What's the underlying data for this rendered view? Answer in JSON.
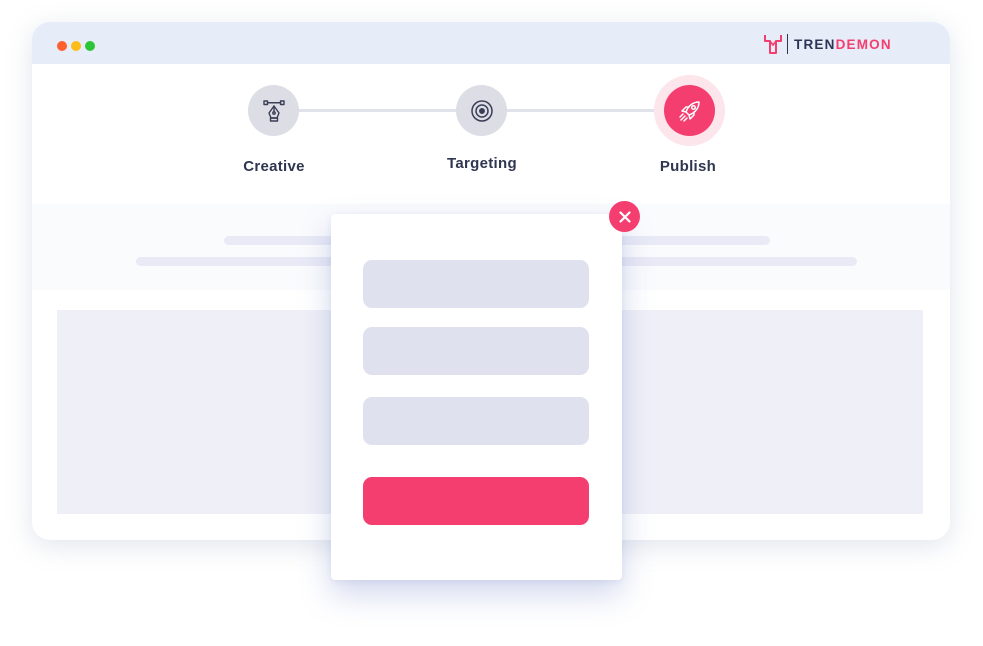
{
  "window": {
    "controls": [
      "close",
      "minimize",
      "maximize"
    ],
    "control_colors": {
      "close": "#fe5f2f",
      "minimize": "#fdbc17",
      "maximize": "#2cc535"
    }
  },
  "brand": {
    "text_part1": "TREN",
    "text_part2": "DEMON",
    "icon": "trendemon-logo-icon",
    "colors": {
      "dark": "#2c3553",
      "accent": "#f43e6f"
    }
  },
  "steps": [
    {
      "label": "Creative",
      "icon": "pen-tool-icon",
      "active": false
    },
    {
      "label": "Targeting",
      "icon": "target-icon",
      "active": false
    },
    {
      "label": "Publish",
      "icon": "rocket-icon",
      "active": true
    }
  ],
  "modal": {
    "fields": [
      {
        "value": "",
        "placeholder": ""
      },
      {
        "value": "",
        "placeholder": ""
      },
      {
        "value": "",
        "placeholder": ""
      }
    ],
    "submit_label": "",
    "close_icon": "close-icon"
  },
  "colors": {
    "accent": "#f43e6f",
    "inactive_step": "#dcdde5",
    "field_bg": "#e0e1ee",
    "titlebar": "#e6edf8"
  }
}
